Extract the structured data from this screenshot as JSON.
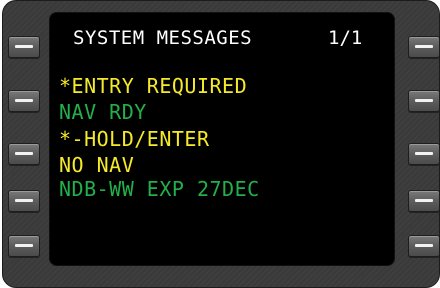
{
  "display": {
    "title": "SYSTEM MESSAGES",
    "page": "1/1"
  },
  "messages": [
    {
      "text": "*ENTRY REQUIRED",
      "color": "#f5ea2a"
    },
    {
      "text": "NAV RDY",
      "color": "#22b04a"
    },
    {
      "text": "*-HOLD/ENTER",
      "color": "#f5ea2a"
    },
    {
      "text": "NO NAV",
      "color": "#f5ea2a"
    },
    {
      "text": "NDB-WW EXP 27DEC",
      "color": "#22b04a"
    }
  ],
  "colors": {
    "bezel": "#3a3a3a",
    "screen": "#000000",
    "title": "#ffffff",
    "advisory_yellow": "#f5ea2a",
    "status_green": "#22b04a"
  },
  "line_select_keys": {
    "left": [
      "lsk-1l",
      "lsk-2l",
      "lsk-3l",
      "lsk-4l",
      "lsk-5l"
    ],
    "right": [
      "lsk-1r",
      "lsk-2r",
      "lsk-3r",
      "lsk-4r",
      "lsk-5r"
    ]
  }
}
